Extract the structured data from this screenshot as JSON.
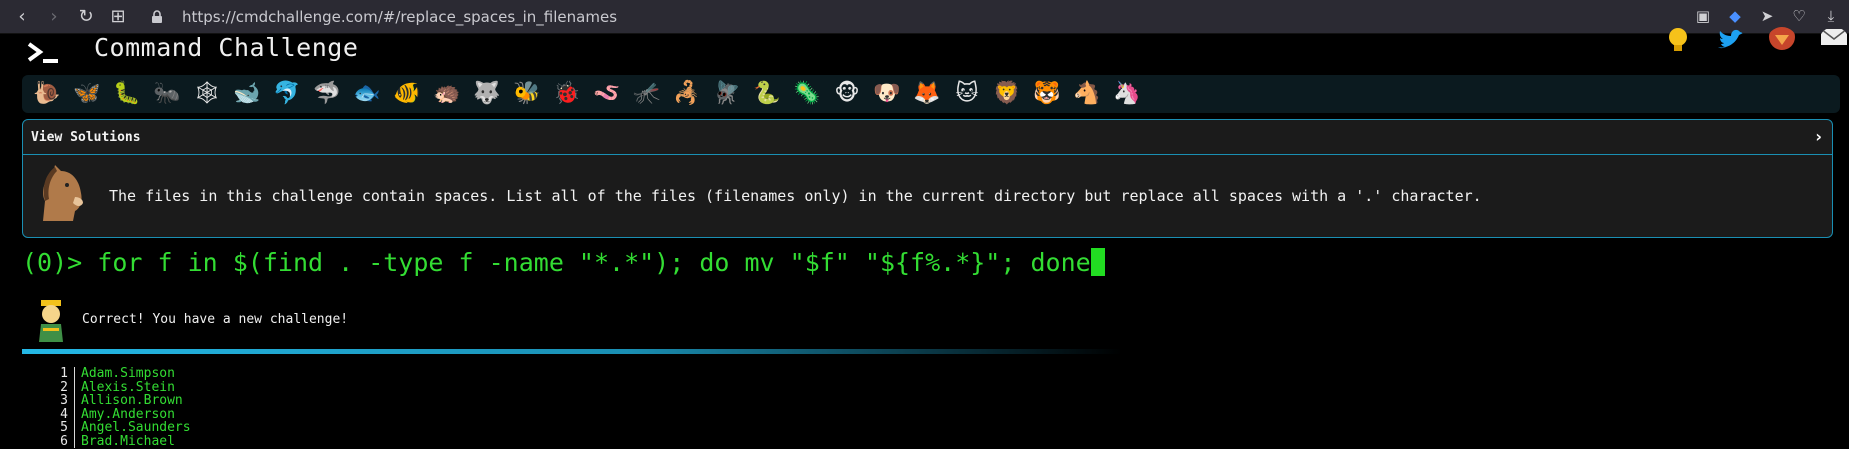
{
  "browser": {
    "url": "https://cmdchallenge.com/#/replace_spaces_in_filenames"
  },
  "header": {
    "title": "Command Challenge"
  },
  "panel": {
    "title": "View Solutions",
    "description": "The files in this challenge contain spaces. List all of the files (filenames only) in the current directory but replace all spaces with a '.' character."
  },
  "command": {
    "prompt": "(0)>",
    "text": "for f in $(find . -type f -name \"*.*\"); do mv \"$f\" \"${f%.*}\"; done"
  },
  "result": {
    "message": "Correct! You have a new challenge!"
  },
  "output": {
    "rows": [
      {
        "num": "1",
        "text": "Adam.Simpson"
      },
      {
        "num": "2",
        "text": "Alexis.Stein"
      },
      {
        "num": "3",
        "text": "Allison.Brown"
      },
      {
        "num": "4",
        "text": "Amy.Anderson"
      },
      {
        "num": "5",
        "text": "Angel.Saunders"
      },
      {
        "num": "6",
        "text": "Brad.Michael"
      }
    ]
  },
  "colors": {
    "accent": "#1a8fb3",
    "prompt_green": "#33dd33",
    "panel_bg": "#1b1b1b"
  }
}
